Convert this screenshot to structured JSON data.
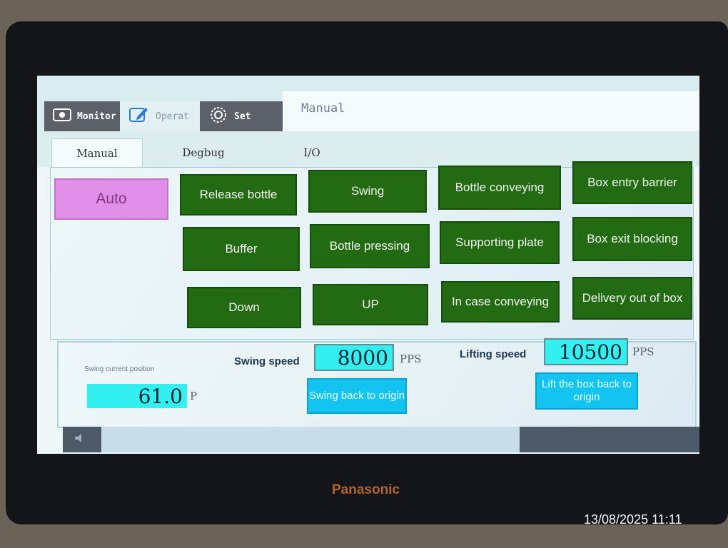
{
  "nav": {
    "tabs": [
      "Monitor",
      "Operat",
      "Set"
    ],
    "active": "Operat",
    "screen_title": "Manual"
  },
  "subtabs": [
    "Manual",
    "Degbug",
    "I/O"
  ],
  "buttons": {
    "auto": "Auto",
    "release_bottle": "Release bottle",
    "swing": "Swing",
    "bottle_conveying": "Bottle conveying",
    "box_entry_barrier": "Box entry barrier",
    "buffer": "Buffer",
    "bottle_pressing": "Bottle pressing",
    "supporting_plate": "Supporting plate",
    "box_exit_blocking": "Box exit blocking",
    "down": "Down",
    "up": "UP",
    "in_case_conveying": "In case conveying",
    "delivery_out_of_box": "Delivery out of box"
  },
  "params": {
    "swing_position_label": "Swing current position",
    "swing_position_value": "61.0",
    "swing_position_unit": "P",
    "swing_speed_label": "Swing speed",
    "swing_speed_value": "8000",
    "swing_speed_unit": "PPS",
    "lifting_speed_label": "Lifting speed",
    "lifting_speed_value": "10500",
    "lifting_speed_unit": "PPS",
    "swing_back_label": "Swing back to origin",
    "lift_back_label": "Lift the box back to origin"
  },
  "device": {
    "brand": "Panasonic",
    "photo_timestamp": "13/08/2025 11:11"
  },
  "colors": {
    "button_green": "#226b12",
    "auto_pink": "#e18ee8",
    "field_cyan": "#33f0f0",
    "action_cyan": "#14c4f0"
  }
}
